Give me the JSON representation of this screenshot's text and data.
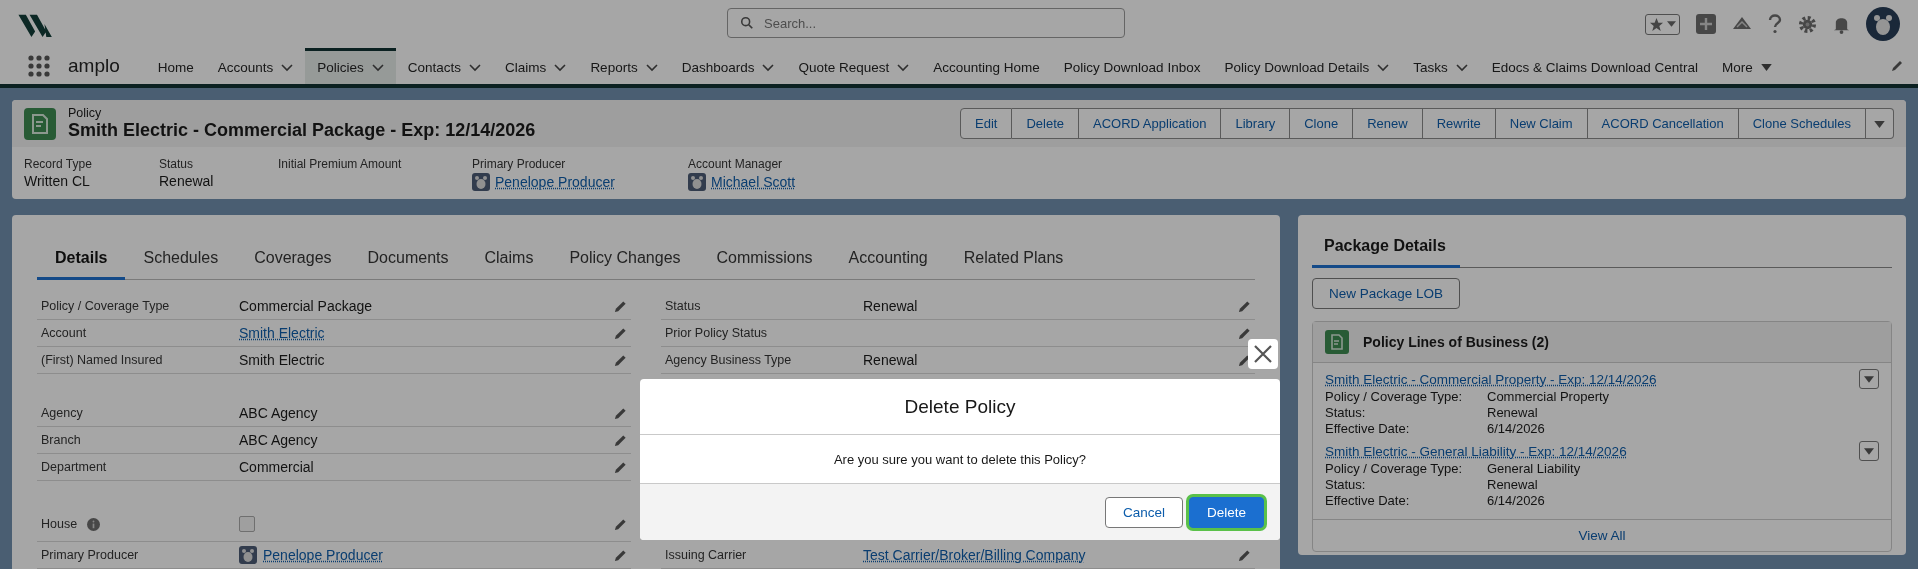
{
  "app": {
    "name": "amplo",
    "search": {
      "placeholder": "Search..."
    }
  },
  "nav": [
    {
      "label": "Home",
      "kind": "plain",
      "selected": false
    },
    {
      "label": "Accounts",
      "kind": "menu",
      "selected": false
    },
    {
      "label": "Policies",
      "kind": "menu",
      "selected": true
    },
    {
      "label": "Contacts",
      "kind": "menu",
      "selected": false
    },
    {
      "label": "Claims",
      "kind": "menu",
      "selected": false
    },
    {
      "label": "Reports",
      "kind": "menu",
      "selected": false
    },
    {
      "label": "Dashboards",
      "kind": "menu",
      "selected": false
    },
    {
      "label": "Quote Request",
      "kind": "menu",
      "selected": false
    },
    {
      "label": "Accounting Home",
      "kind": "plain",
      "selected": false
    },
    {
      "label": "Policy Download Inbox",
      "kind": "plain",
      "selected": false
    },
    {
      "label": "Policy Download Details",
      "kind": "menu",
      "selected": false
    },
    {
      "label": "Tasks",
      "kind": "menu",
      "selected": false
    },
    {
      "label": "Edocs & Claims Download Central",
      "kind": "plain",
      "selected": false
    },
    {
      "label": "More",
      "kind": "overflow",
      "selected": false
    }
  ],
  "record": {
    "object": "Policy",
    "title": "Smith Electric - Commercial Package - Exp: 12/14/2026",
    "actions": [
      "Edit",
      "Delete",
      "ACORD Application",
      "Library",
      "Clone",
      "Renew",
      "Rewrite",
      "New Claim",
      "ACORD Cancellation",
      "Clone Schedules"
    ],
    "fields": [
      {
        "label": "Record Type",
        "value": "Written CL",
        "kind": "text"
      },
      {
        "label": "Status",
        "value": "Renewal",
        "kind": "text"
      },
      {
        "label": "Initial Premium Amount",
        "kind": "text"
      },
      {
        "label": "Primary Producer",
        "value": "Penelope Producer",
        "kind": "user"
      },
      {
        "label": "Account Manager",
        "value": "Michael Scott",
        "kind": "user"
      }
    ]
  },
  "tabs": [
    {
      "label": "Details",
      "selected": true
    },
    {
      "label": "Schedules",
      "selected": false
    },
    {
      "label": "Coverages",
      "selected": false
    },
    {
      "label": "Documents",
      "selected": false
    },
    {
      "label": "Claims",
      "selected": false
    },
    {
      "label": "Policy Changes",
      "selected": false
    },
    {
      "label": "Commissions",
      "selected": false
    },
    {
      "label": "Accounting",
      "selected": false
    },
    {
      "label": "Related Plans",
      "selected": false
    }
  ],
  "details": {
    "columns": [
      {
        "groups": [
          [
            {
              "label": "Policy / Coverage Type",
              "value": "Commercial Package",
              "kind": "text",
              "info": false
            },
            {
              "label": "Account",
              "value": "Smith Electric",
              "kind": "link",
              "info": false
            },
            {
              "label": "(First) Named Insured",
              "value": "Smith Electric",
              "kind": "text",
              "info": false
            }
          ],
          [
            {
              "label": "Agency",
              "value": "ABC Agency",
              "kind": "text",
              "info": false
            },
            {
              "label": "Branch",
              "value": "ABC Agency",
              "kind": "text",
              "info": false
            },
            {
              "label": "Department",
              "value": "Commercial",
              "kind": "text",
              "info": false
            }
          ],
          [
            {
              "label": "House",
              "kind": "checkbox",
              "checked": false,
              "info": true
            },
            {
              "label": "Primary Producer",
              "value": "Penelope Producer",
              "kind": "user",
              "info": false
            }
          ]
        ]
      },
      {
        "groups": [
          [
            {
              "label": "Status",
              "value": "Renewal",
              "kind": "text",
              "info": false
            },
            {
              "label": "Prior Policy Status",
              "kind": "text",
              "info": false
            },
            {
              "label": "Agency Business Type",
              "value": "Renewal",
              "kind": "text",
              "info": false
            }
          ],
          [
            {
              "label": "Issuing Carrier",
              "value": "Test Carrier/Broker/Billing Company",
              "kind": "link",
              "info": false
            }
          ]
        ]
      }
    ]
  },
  "package": {
    "tab": "Package Details",
    "button": "New Package LOB",
    "related": {
      "title": "Policy Lines of Business (2)",
      "footer": "View All",
      "items": [
        {
          "name": "Smith Electric - Commercial Property - Exp: 12/14/2026",
          "fields": [
            {
              "label": "Policy / Coverage Type:",
              "value": "Commercial Property"
            },
            {
              "label": "Status:",
              "value": "Renewal"
            },
            {
              "label": "Effective Date:",
              "value": "6/14/2026"
            }
          ]
        },
        {
          "name": "Smith Electric - General Liability - Exp: 12/14/2026",
          "fields": [
            {
              "label": "Policy / Coverage Type:",
              "value": "General Liability"
            },
            {
              "label": "Status:",
              "value": "Renewal"
            },
            {
              "label": "Effective Date:",
              "value": "6/14/2026"
            }
          ]
        }
      ]
    }
  },
  "modal": {
    "title": "Delete Policy",
    "message": "Are you sure you want to delete this Policy?",
    "buttons": [
      {
        "label": "Cancel",
        "kind": "neutral",
        "focused": false
      },
      {
        "label": "Delete",
        "kind": "brand",
        "focused": true
      }
    ]
  }
}
